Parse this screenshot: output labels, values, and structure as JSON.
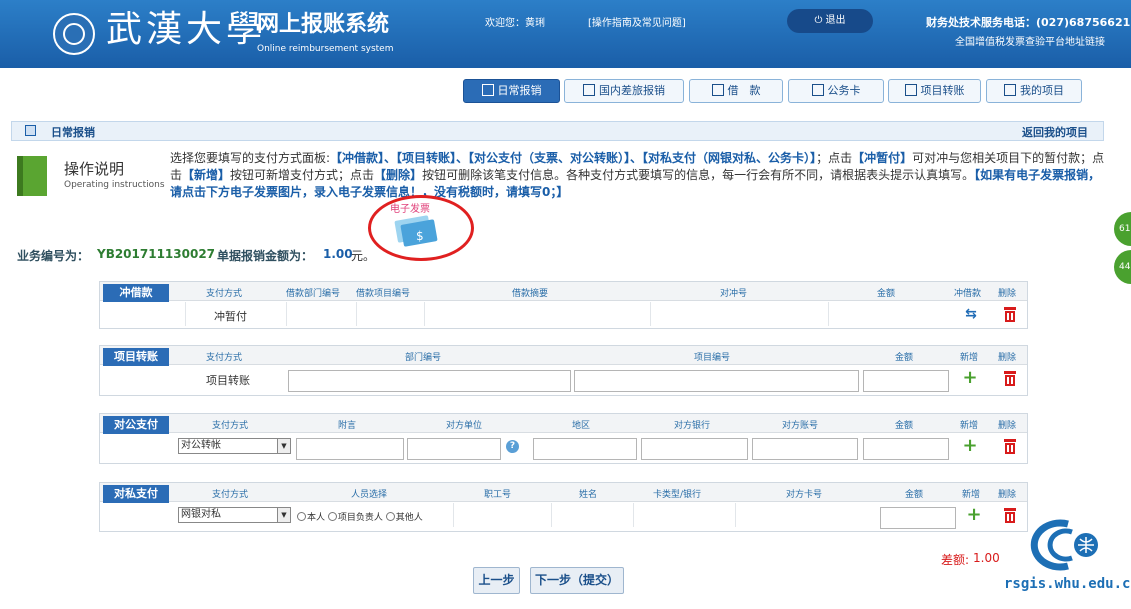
{
  "header": {
    "university_name": "武漢大學",
    "system_title": "网上报账系统",
    "system_subtitle": "Online reimbursement system",
    "welcome_text": "欢迎您：黄琍",
    "guide_link": "[操作指南及常见问题]",
    "logout_label": "退出",
    "service_phone": "财务处技术服务电话：(027)68756621",
    "invoice_link": "全国增值税发票查验平台地址链接"
  },
  "nav_tabs": [
    {
      "label": "日常报销",
      "active": true
    },
    {
      "label": "国内差旅报销",
      "active": false
    },
    {
      "label": "借　款",
      "active": false
    },
    {
      "label": "公务卡",
      "active": false
    },
    {
      "label": "项目转账",
      "active": false
    },
    {
      "label": "我的项目",
      "active": false
    }
  ],
  "page_bar": {
    "title": "日常报销",
    "back_link": "返回我的项目"
  },
  "instructions": {
    "title": "操作说明",
    "subtitle": "Operating instructions",
    "text_intro": "选择您要填写的支付方式面板:",
    "text_methods": "【冲借款】、【项目转账】、【对公支付（支票、对公转账）】、【对私支付（网银对私、公务卡）】",
    "text_click1": "；点击",
    "text_btn_temp": "【冲暂付】",
    "text_temp_desc": "可对冲与您相关项目下的暂付款；点击",
    "text_btn_add": "【新增】",
    "text_add_desc": "按钮可新增支付方式；点击",
    "text_btn_del": "【删除】",
    "text_del_desc": "按钮可删除该笔支付信息。各种支付方式要填写的信息，每一行会有所不同，请根据表头提示认真填写。",
    "text_einvoice": "【如果有电子发票报销，请点击下方电子发票图片，录入电子发票信息！，没有税额时，请填写0；】",
    "invoice_image_label": "电子发票"
  },
  "summary": {
    "biz_label": "业务编号为：",
    "biz_number": "YB201711130027",
    "amount_label": "单据报销金额为：",
    "amount_value": "1.00",
    "amount_unit": "元。"
  },
  "sections": {
    "offset_loan": {
      "name": "冲借款",
      "headers": [
        "支付方式",
        "借款部门编号",
        "借款项目编号",
        "借款摘要",
        "对冲号",
        "金额",
        "冲借款",
        "删除"
      ],
      "row": {
        "method": "冲暂付"
      }
    },
    "project_transfer": {
      "name": "项目转账",
      "headers": [
        "支付方式",
        "部门编号",
        "项目编号",
        "金额",
        "新增",
        "删除"
      ],
      "row": {
        "method": "项目转账"
      }
    },
    "public_payment": {
      "name": "对公支付",
      "headers": [
        "支付方式",
        "附言",
        "对方单位",
        "地区",
        "对方银行",
        "对方账号",
        "金额",
        "新增",
        "删除"
      ],
      "row": {
        "method": "对公转帐"
      }
    },
    "private_payment": {
      "name": "对私支付",
      "headers": [
        "支付方式",
        "人员选择",
        "职工号",
        "姓名",
        "卡类型/银行",
        "对方卡号",
        "金额",
        "新增",
        "删除"
      ],
      "row": {
        "method": "网银对私",
        "options": [
          "本人",
          "项目负责人",
          "其他人"
        ]
      }
    }
  },
  "difference": {
    "label": "差额:",
    "value": "1.00"
  },
  "buttons": {
    "prev": "上一步",
    "next": "下一步（提交）"
  },
  "watermark": "rsgis.whu.edu.cn",
  "side_tabs": [
    "61",
    "44"
  ],
  "colors": {
    "header_blue": "#1a5ea8",
    "accent_green": "#4aa12f",
    "danger_red": "#d81b1b"
  }
}
